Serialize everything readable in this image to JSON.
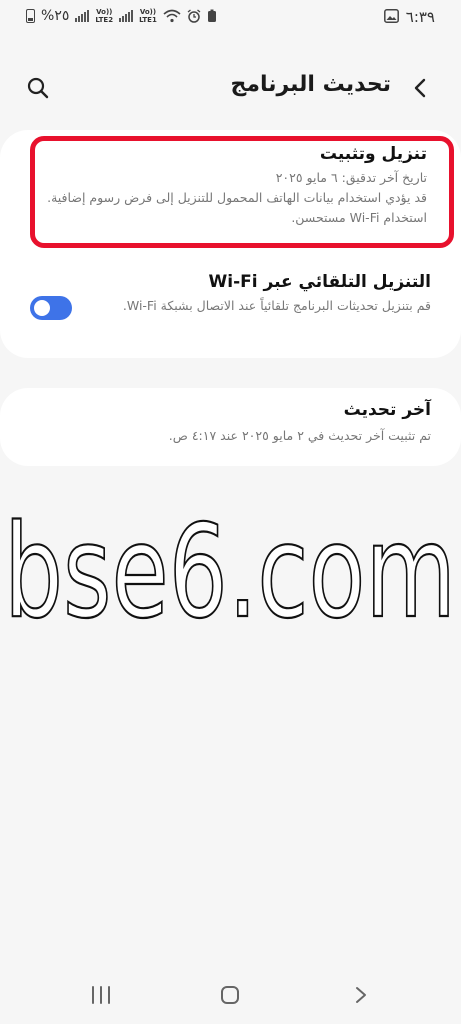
{
  "status_bar": {
    "time": "٦:٣٩",
    "battery_pct": "%٢٥",
    "sim1_label": "Vo))\nLTE2",
    "sim2_label": "Vo))\nLTE1",
    "icons": [
      "battery-icon",
      "signal-icon",
      "signal-icon",
      "wifi-icon",
      "alarm-icon",
      "battery-saver-icon",
      "gallery-icon"
    ]
  },
  "header": {
    "title": "تحديث البرنامج",
    "back_icon": "chevron-left-icon",
    "search_icon": "search-icon"
  },
  "settings": {
    "download_install": {
      "title": "تنزيل وتثبيت",
      "last_checked": "تاريخ آخر تدقيق: ٦ مايو ٢٠٢٥",
      "warning": "قد يؤدي استخدام بيانات الهاتف المحمول للتنزيل إلى فرض رسوم إضافية. استخدام Wi-Fi مستحسن."
    },
    "auto_download": {
      "title": "التنزيل التلقائي عبر Wi-Fi",
      "description": "قم بتنزيل تحديثات البرنامج تلقائياً عند الاتصال بشبكة Wi-Fi.",
      "enabled": true
    },
    "last_update": {
      "title": "آخر تحديث",
      "description": "تم تثبيت آخر تحديث في ٢ مايو ٢٠٢٥ عند ٤:١٧ ص."
    }
  },
  "watermark": {
    "text": "bse6.com"
  },
  "nav_bar": {
    "icons": [
      "recent-apps-icon",
      "home-icon",
      "back-icon"
    ]
  },
  "colors": {
    "accent": "#3e73e8",
    "highlight": "#e8112d",
    "background": "#f6f6f6"
  }
}
